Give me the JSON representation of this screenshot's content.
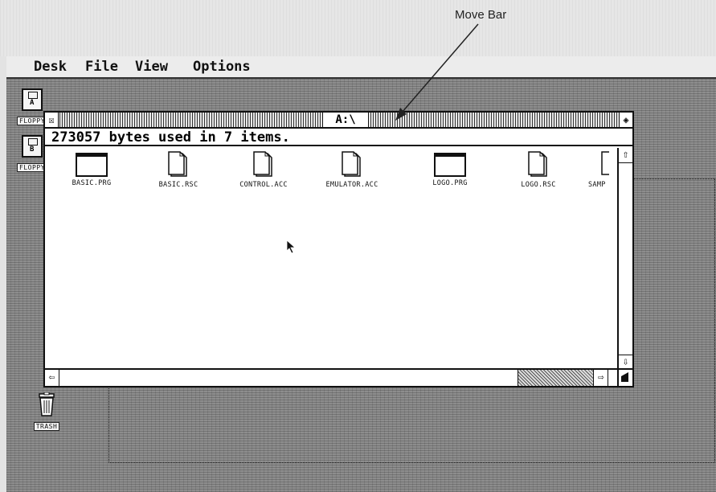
{
  "annotation": {
    "label": "Move Bar"
  },
  "menubar": {
    "items": [
      "Desk",
      "File",
      "View",
      "Options"
    ]
  },
  "desktop": {
    "icons": [
      {
        "label": "FLOPPY",
        "art_letter": "A"
      },
      {
        "label": "FLOPPY",
        "art_letter": "B"
      },
      {
        "label": "TRASH"
      }
    ]
  },
  "window": {
    "title": "A:\\",
    "close_glyph": "☒",
    "fuller_glyph": "◈",
    "info": "273057 bytes used in 7 items.",
    "files": [
      {
        "name": "BASIC.PRG",
        "kind": "program"
      },
      {
        "name": "BASIC.RSC",
        "kind": "document"
      },
      {
        "name": "CONTROL.ACC",
        "kind": "document"
      },
      {
        "name": "EMULATOR.ACC",
        "kind": "document"
      },
      {
        "name": "LOGO.PRG",
        "kind": "program"
      },
      {
        "name": "LOGO.RSC",
        "kind": "document"
      },
      {
        "name": "SAMP",
        "kind": "document"
      }
    ],
    "scroll": {
      "up": "⇧",
      "down": "⇩",
      "left": "⇦",
      "right": "⇨"
    }
  },
  "colors": {
    "desktop": "#8d8d8d",
    "window": "#ffffff",
    "ink": "#111111"
  }
}
